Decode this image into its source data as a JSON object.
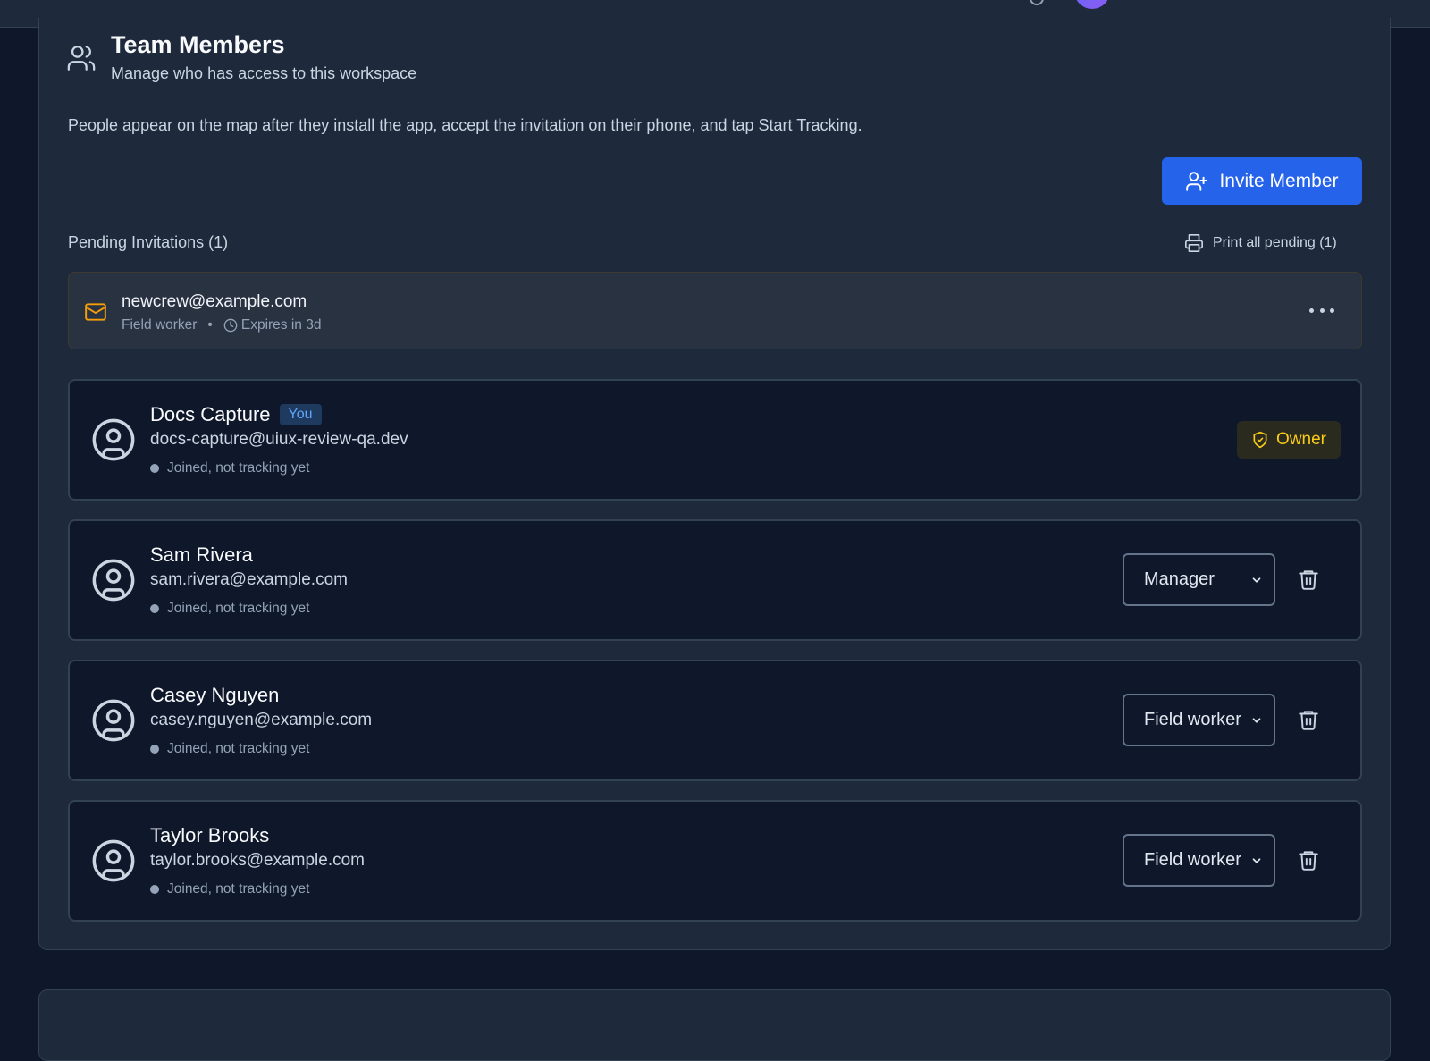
{
  "header": {
    "title": "Team Members",
    "subtitle": "Manage who has access to this workspace",
    "info": "People appear on the map after they install the app, accept the invitation on their phone, and tap Start Tracking."
  },
  "invite_button": {
    "label": "Invite Member",
    "icon": "user-plus-icon"
  },
  "pending": {
    "title": "Pending Invitations (1)",
    "print_label": "Print all pending (1)",
    "invitations": [
      {
        "email": "newcrew@example.com",
        "role": "Field worker",
        "separator": "•",
        "expires": "Expires in 3d"
      }
    ]
  },
  "members": [
    {
      "name": "Docs Capture",
      "badge": "You",
      "email": "docs-capture@uiux-review-qa.dev",
      "status": "Joined, not tracking yet",
      "role_badge": "Owner"
    },
    {
      "name": "Sam Rivera",
      "email": "sam.rivera@example.com",
      "status": "Joined, not tracking yet",
      "role": "Manager"
    },
    {
      "name": "Casey Nguyen",
      "email": "casey.nguyen@example.com",
      "status": "Joined, not tracking yet",
      "role": "Field worker"
    },
    {
      "name": "Taylor Brooks",
      "email": "taylor.brooks@example.com",
      "status": "Joined, not tracking yet",
      "role": "Field worker"
    }
  ],
  "colors": {
    "background": "#0f172a",
    "panel": "#1e293b",
    "accent": "#2563eb",
    "owner": "#facc15",
    "you_badge": "#60a5fa",
    "mail_icon": "#f59e0b"
  }
}
